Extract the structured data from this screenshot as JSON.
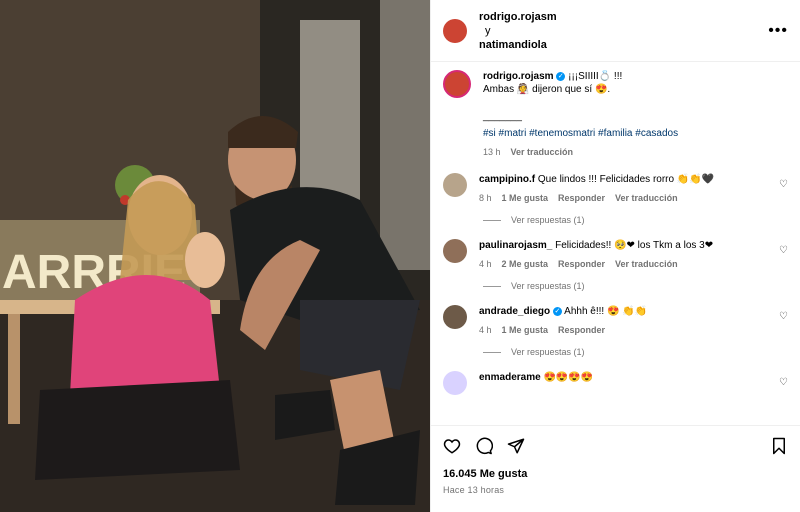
{
  "post": {
    "header": {
      "username": "rodrigo.rojasm",
      "and": "y",
      "collab_username": "natimandiola",
      "more_glyph": "•••"
    },
    "caption": {
      "username": "rodrigo.rojasm",
      "line1": "¡¡¡SIIIII💍 !!!",
      "line2": "Ambas 👰 dijeron que sí 😍.",
      "separator": "_______",
      "hashtags": "#si #matri #tenemosmatri #familia #casados",
      "time": "13 h",
      "translate": "Ver traducción"
    },
    "comments": [
      {
        "username": "campipino.f",
        "text": "Que lindos !!! Felicidades rorro 👏👏🖤",
        "time": "8 h",
        "likes": "1 Me gusta",
        "reply": "Responder",
        "translate": "Ver traducción",
        "view_replies": "Ver respuestas (1)"
      },
      {
        "username": "paulinarojasm_",
        "text": "Felicidades!! 🥺❤ los Tkm a los 3❤",
        "time": "4 h",
        "likes": "2 Me gusta",
        "reply": "Responder",
        "translate": "Ver traducción",
        "view_replies": "Ver respuestas (1)"
      },
      {
        "username": "andrade_diego",
        "text": "Ahhh ê!!! 😍 👏👏",
        "time": "4 h",
        "likes": "1 Me gusta",
        "reply": "Responder",
        "view_replies": "Ver respuestas (1)"
      },
      {
        "username": "enmaderame",
        "text": "😍😍😍😍"
      }
    ],
    "footer": {
      "likes": "16.045 Me gusta",
      "time_ago": "Hace 13 horas"
    },
    "photo_sign_text": "ARRRIE",
    "icons": {
      "like": "heart-outline-icon",
      "comment": "comment-bubble-icon",
      "share": "paper-plane-icon",
      "save": "bookmark-icon"
    }
  }
}
